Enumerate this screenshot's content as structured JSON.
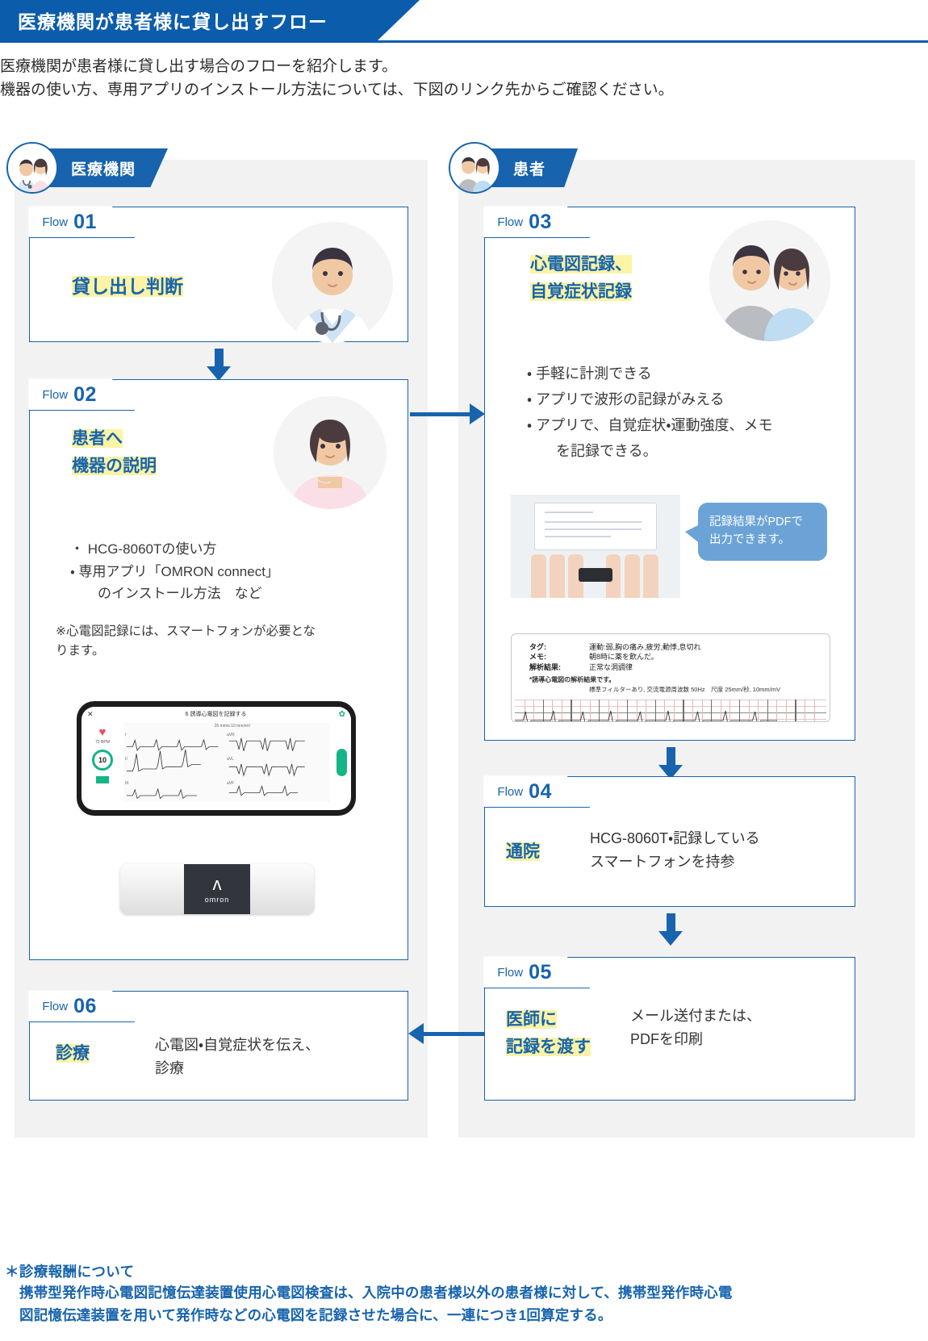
{
  "header": {
    "title": "医療機関が患者様に貸し出すフロー"
  },
  "intro": {
    "line1": "医療機関が患者様に貸し出す場合のフローを紹介します。",
    "line2": "機器の使い方、専用アプリのインストール方法については、下図のリンク先からご確認ください。"
  },
  "roles": {
    "left": {
      "label": "医療機関"
    },
    "right": {
      "label": "患者"
    }
  },
  "flow_word": "Flow",
  "cards": {
    "f01": {
      "num": "01",
      "title": "貸し出し判断"
    },
    "f02": {
      "num": "02",
      "title_line1": "患者へ",
      "title_line2": "機器の説明",
      "bullets": [
        "・ HCG-8060Tの使い方",
        "・ 専用アプリ「OMRON connect」",
        "　　のインストール方法　など"
      ],
      "note_line1": "※心電図記録には、スマートフォンが必要とな",
      "note_line2": "ります。"
    },
    "f03": {
      "num": "03",
      "title_line1": "心電図記録、",
      "title_line2": "自覚症状記録",
      "bullets": [
        "・ 手軽に計測できる",
        "・ アプリで波形の記録がみえる",
        "・ アプリで、自覚症状・運動強度、メモ",
        "　　を記録できる。"
      ],
      "bubble_line1": "記録結果がPDFで",
      "bubble_line2": "出力できます。"
    },
    "f04": {
      "num": "04",
      "title": "通院",
      "body_line1": "HCG-8060T・記録している",
      "body_line2": "スマートフォンを持参"
    },
    "f05": {
      "num": "05",
      "title_line1": "医師に",
      "title_line2": "記録を渡す",
      "body_line1": "メール送付または、",
      "body_line2": "PDFを印刷"
    },
    "f06": {
      "num": "06",
      "title": "診療",
      "body_line1": "心電図・自覚症状を伝え、",
      "body_line2": "診療"
    }
  },
  "phone_app": {
    "close_icon": "✕",
    "gear_icon": "✿",
    "screen_title": "6 誘導心電図を記録する",
    "scale_label": "25 mm/s  10 mm/mV",
    "bpm": "72 BPM",
    "countdown": "10",
    "leads": [
      "I",
      "aVR",
      "II",
      "aVL",
      "III",
      "aVF"
    ]
  },
  "device": {
    "logo_mark": "ʌ",
    "logo_text": "omron"
  },
  "report": {
    "rows": [
      {
        "key": "タグ:",
        "value": "運動:弱,胸の痛み,疲労,動悸,息切れ"
      },
      {
        "key": "メモ:",
        "value": "朝8時に薬を飲んだ。"
      },
      {
        "key": "解析結果:",
        "value": "正常な洞調律"
      }
    ],
    "sub": "*誘導心電図の解析結果です。",
    "sub2": "標準フィルターあり, 交流電源周波数 50Hz　尺度 25mm/秒, 10mm/mV"
  },
  "footer": {
    "title": "＊診療報酬について",
    "body_line1": "携帯型発作時心電図記憶伝達装置使用心電図検査は、入院中の患者様以外の患者様に対して、携帯型発作時心電",
    "body_line2": "図記憶伝達装置を用いて発作時などの心電図を記録させた場合に、一連につき1回算定する。"
  },
  "colors": {
    "brand_blue": "#1763ad",
    "banner_blue": "#0b5cab",
    "highlight_yellow": "#fbf3a6",
    "bubble_blue": "#6ba3d6",
    "panel_gray": "#f2f2f2"
  }
}
